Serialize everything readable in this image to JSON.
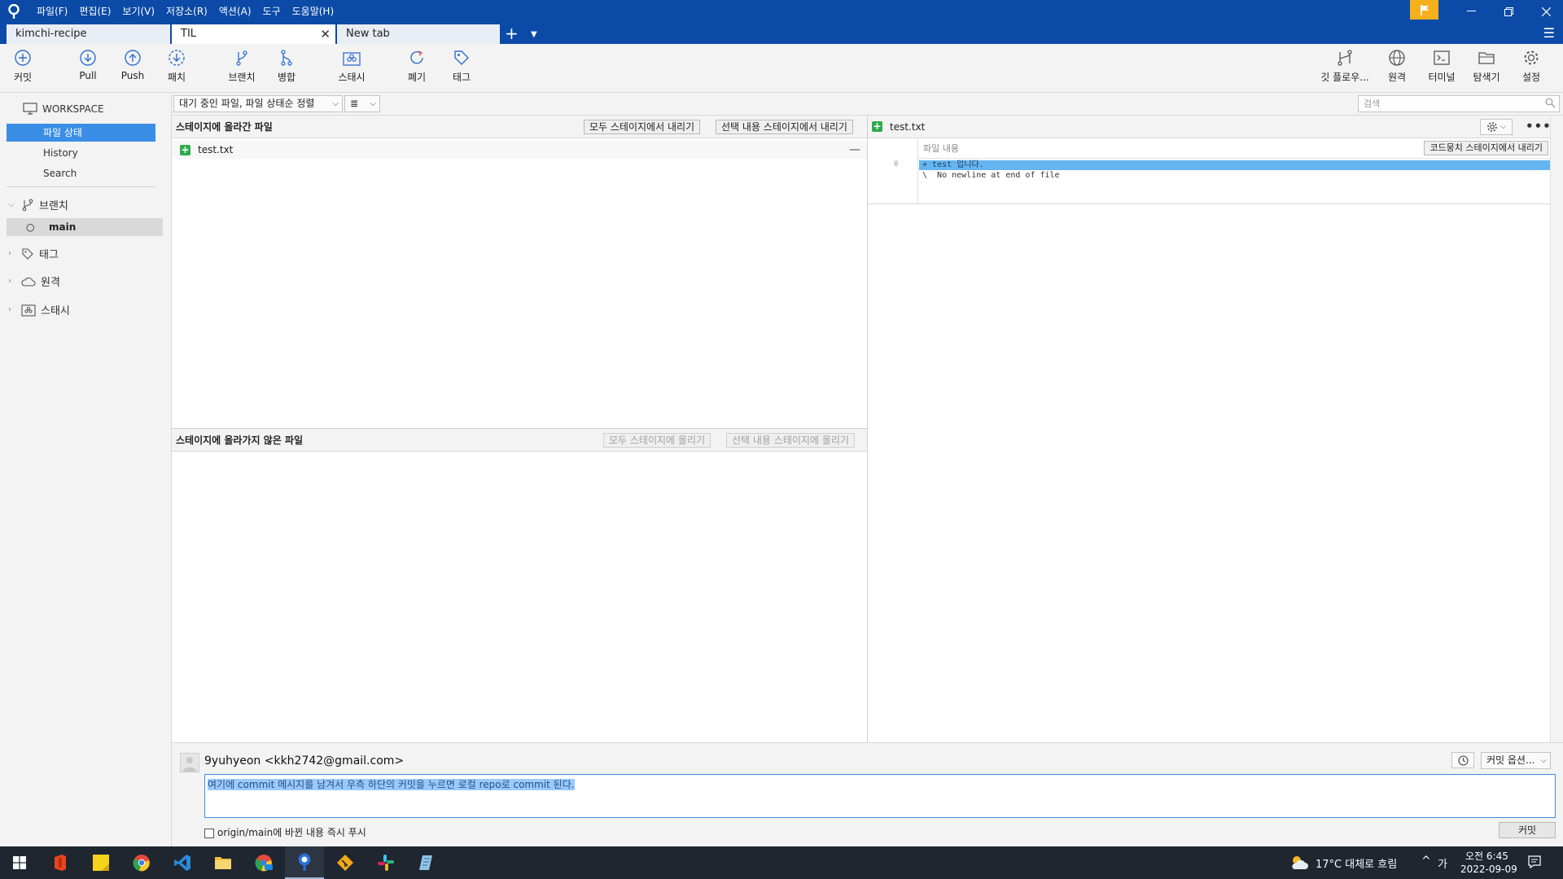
{
  "menu": [
    "파일(F)",
    "편집(E)",
    "보기(V)",
    "저장소(R)",
    "액션(A)",
    "도구",
    "도움말(H)"
  ],
  "tabs": [
    {
      "label": "kimchi-recipe"
    },
    {
      "label": "TIL"
    },
    {
      "label": "New tab"
    }
  ],
  "toolbar": {
    "left": [
      "커밋",
      "Pull",
      "Push",
      "패치",
      "브랜치",
      "병합",
      "스태시",
      "폐기",
      "태그"
    ],
    "right": [
      "깃 플로우...",
      "원격",
      "터미널",
      "탐색기",
      "설정"
    ]
  },
  "sidebar": {
    "workspace": "WORKSPACE",
    "items": [
      "파일 상태",
      "History",
      "Search"
    ],
    "branches_label": "브랜치",
    "current_branch": "main",
    "tags_label": "태그",
    "remotes_label": "원격",
    "stash_label": "스태시"
  },
  "filter": {
    "dropdown": "대기 중인 파일, 파일 상태순 정렬",
    "view_icon": "≣",
    "search_placeholder": "검색"
  },
  "staged": {
    "title": "스테이지에 올라간 파일",
    "unstage_all": "모두 스테이지에서 내리기",
    "unstage_selected": "선택 내용 스테이지에서 내리기",
    "files": [
      "test.txt"
    ]
  },
  "unstaged": {
    "title": "스테이지에 올라가지 않은 파일",
    "stage_all": "모두 스테이지에 올리기",
    "stage_selected": "선택 내용 스테이지에 올리기"
  },
  "diff": {
    "file": "test.txt",
    "hunk_label": "파일 내용",
    "hunk_button": "코드뭉치 스테이지에서 내리기",
    "line_number": "0",
    "lines": [
      "+ test 입니다.",
      "\\  No newline at end of file"
    ]
  },
  "commit": {
    "author": "9yuhyeon <kkh2742@gmail.com>",
    "message": "여기에 commit 메시지를 남겨서 우측 하단의 커밋을 누르면 로컬 repo로 commit 된다.",
    "push_checkbox": "origin/main에 바뀐 내용 즉시 푸시",
    "options": "커밋 옵션...",
    "commit_button": "커밋"
  },
  "taskbar": {
    "weather": "17°C  대체로 흐림",
    "ime": "가",
    "time": "오전 6:45",
    "date": "2022-09-09"
  },
  "colors": {
    "titlebar": "#0b4aa6",
    "selection": "#3a8ee6",
    "added_badge": "#2eaa4c",
    "added_line": "#64b5f0",
    "flag": "#f6b01b"
  }
}
